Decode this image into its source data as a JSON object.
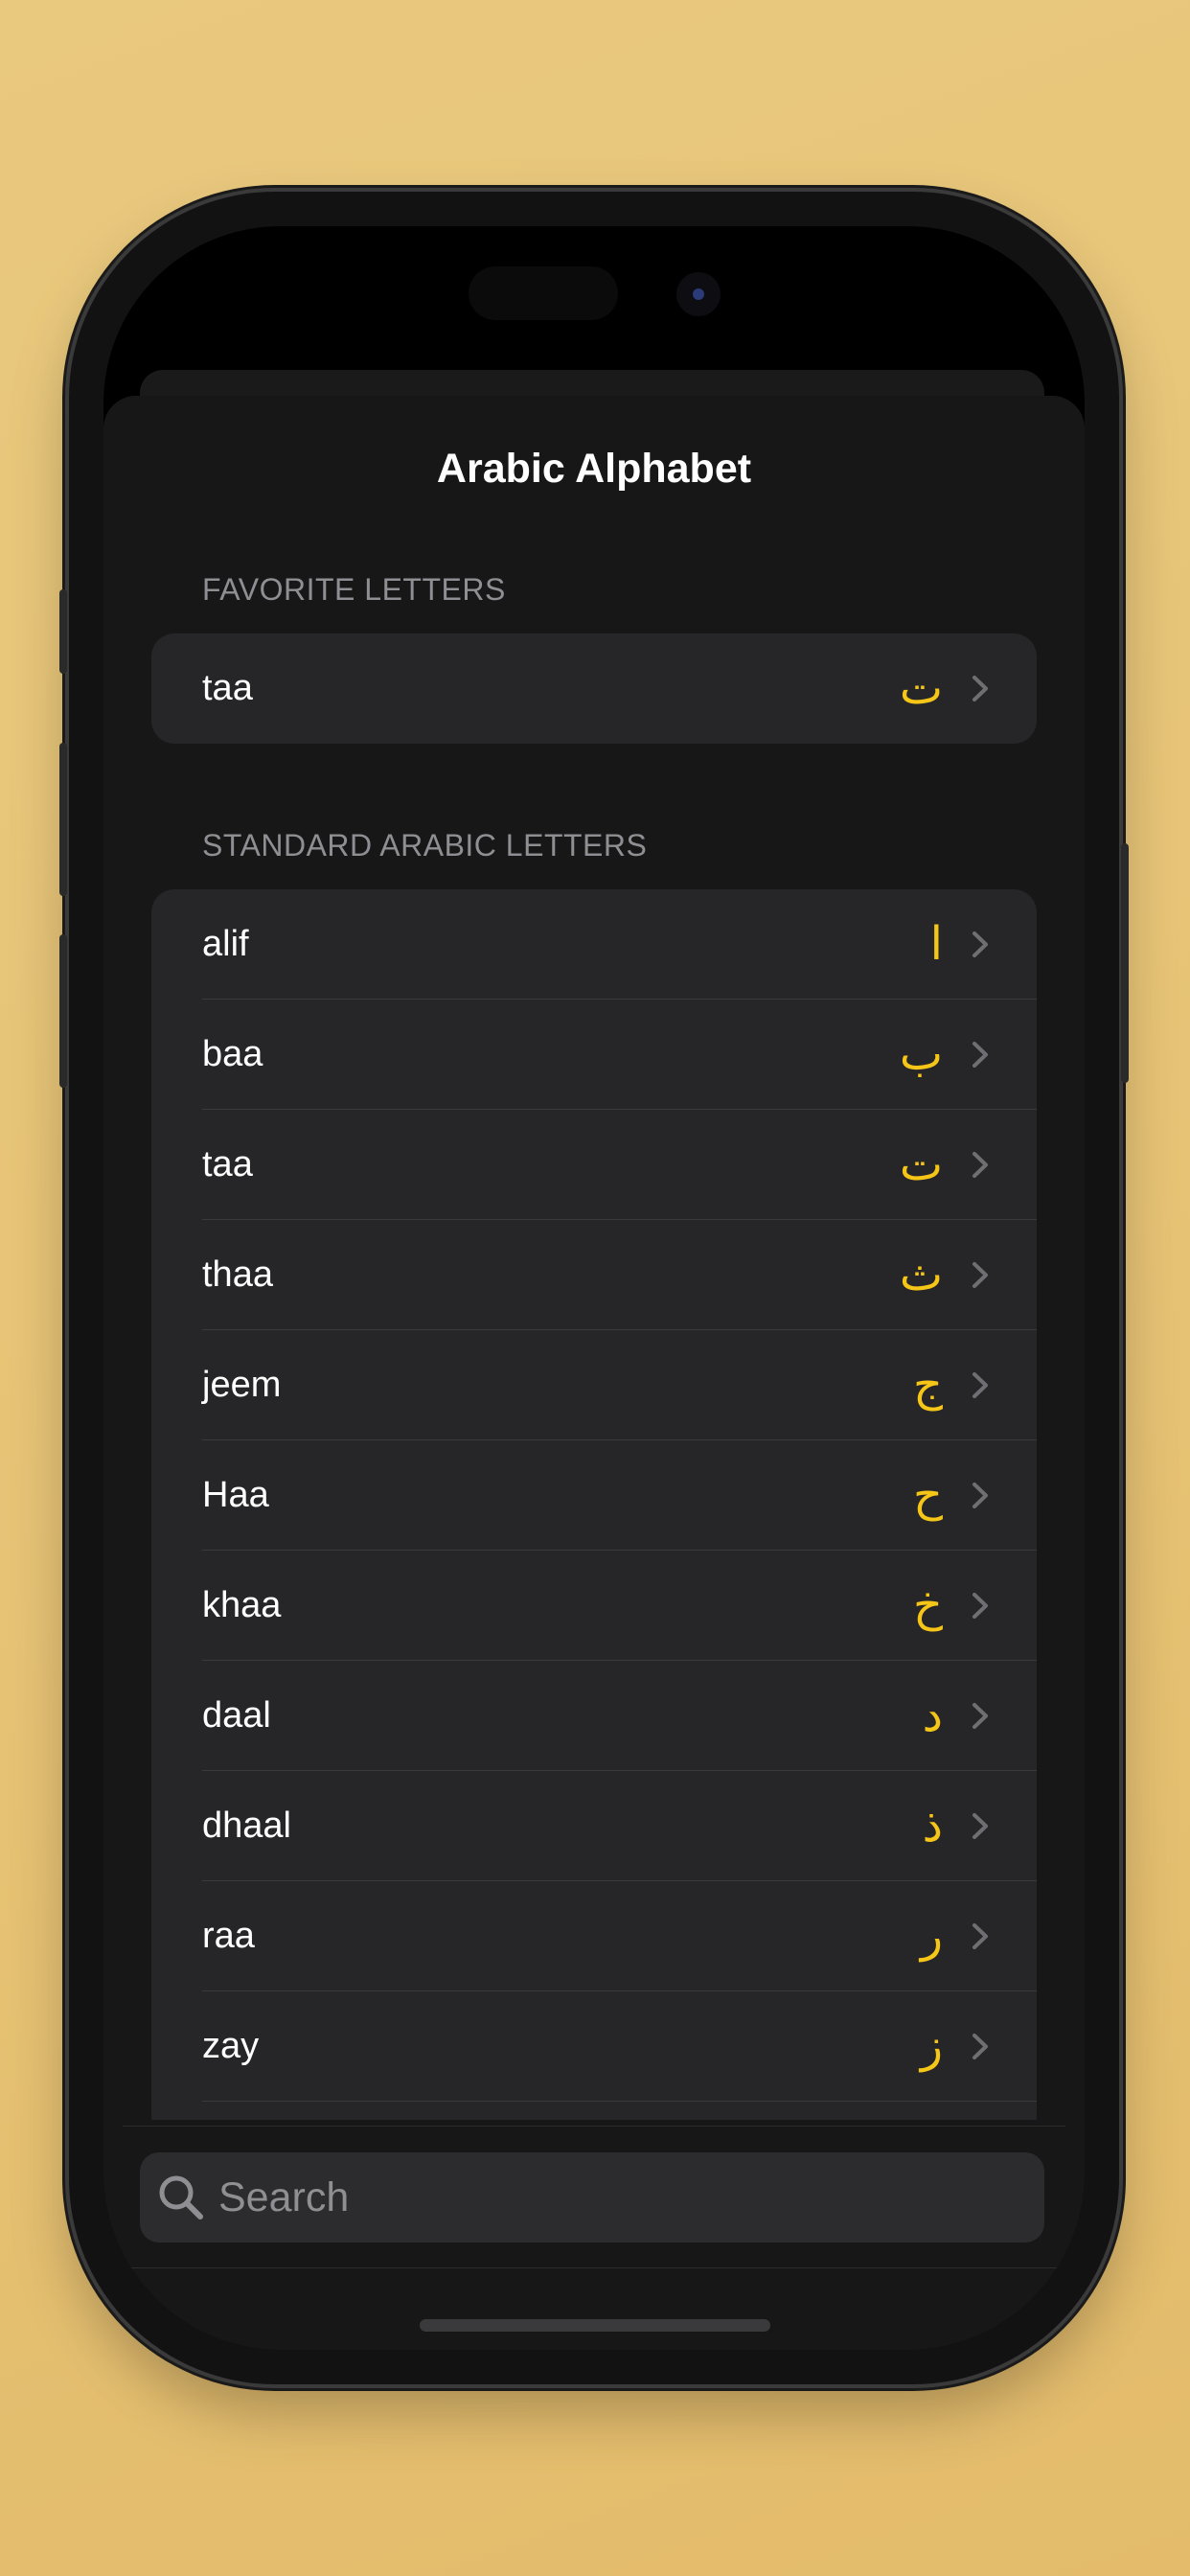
{
  "app": {
    "title": "Arabic Alphabet"
  },
  "sections": {
    "favorites": {
      "header": "FAVORITE LETTERS",
      "items": [
        {
          "name": "taa",
          "letter": "ت"
        }
      ]
    },
    "standard": {
      "header": "STANDARD ARABIC LETTERS",
      "items": [
        {
          "name": "alif",
          "letter": "ا"
        },
        {
          "name": "baa",
          "letter": "ب"
        },
        {
          "name": "taa",
          "letter": "ت"
        },
        {
          "name": "thaa",
          "letter": "ث"
        },
        {
          "name": "jeem",
          "letter": "ج"
        },
        {
          "name": "Haa",
          "letter": "ح"
        },
        {
          "name": "khaa",
          "letter": "خ"
        },
        {
          "name": "daal",
          "letter": "د"
        },
        {
          "name": "dhaal",
          "letter": "ذ"
        },
        {
          "name": "raa",
          "letter": "ر"
        },
        {
          "name": "zay",
          "letter": "ز"
        }
      ]
    }
  },
  "search": {
    "placeholder": "Search",
    "value": ""
  },
  "icons": {
    "search": "magnifying-glass-icon",
    "row_disclosure": "chevron-right-icon"
  },
  "colors": {
    "background": "#e6c274",
    "sheet": "#171717",
    "row_background": "#262628",
    "accent_letter": "#f5c518",
    "secondary_text": "#8e8e93",
    "primary_text": "#ffffff"
  }
}
